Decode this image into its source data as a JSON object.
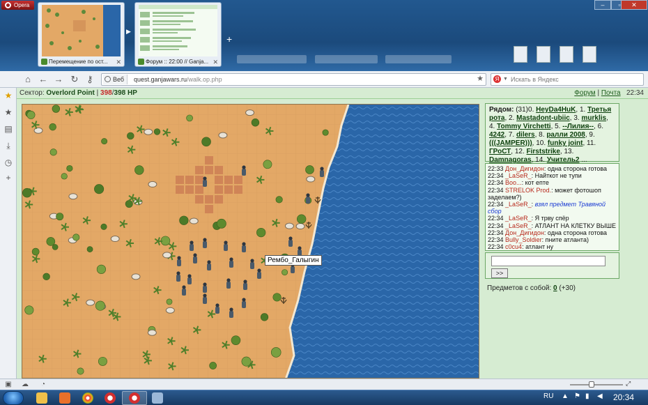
{
  "browser": {
    "menu_label": "Opera",
    "tabs": [
      {
        "title": "Перемещение по ост...",
        "close": "✕"
      },
      {
        "title": "Форум :: 22:00 // Ganja...",
        "close": "✕"
      }
    ],
    "address": {
      "badge": "Веб",
      "url_domain": "quest.ganjawars.ru",
      "url_path": "/walk.op.php"
    },
    "search_placeholder": "Искать в Яндекс",
    "yandex_letter": "Я"
  },
  "game": {
    "sector_label": "Сектор:",
    "sector_name": "Overlord Point",
    "hp_current": "398",
    "hp_sep": "/",
    "hp_max": "398 HP",
    "hp_sep_pipe": "|",
    "links": {
      "forum": "Форум",
      "mail": "Почта",
      "separator": "|"
    },
    "time": "22:34",
    "tooltip_player": "Рембо_Галыгин"
  },
  "nearby": {
    "label": "Рядом:",
    "count": "(31)",
    "players": [
      {
        "n": "0.",
        "name": "HeyDa4HuK"
      },
      {
        "n": "1.",
        "name": "Третья рота"
      },
      {
        "n": "2.",
        "name": "Mastadont-ubiic"
      },
      {
        "n": "3.",
        "name": "murklis"
      },
      {
        "n": "4.",
        "name": "Tommy Virchetti"
      },
      {
        "n": "5.",
        "name": "--Лилия--"
      },
      {
        "n": "6.",
        "name": "4242"
      },
      {
        "n": "7.",
        "name": "dilers"
      },
      {
        "n": "8.",
        "name": "ралли 2008"
      },
      {
        "n": "9.",
        "name": "(((JAMPER)))"
      },
      {
        "n": "10.",
        "name": "funky joint"
      },
      {
        "n": "11.",
        "name": "ГРоСТ"
      },
      {
        "n": "12.",
        "name": "Firststrike"
      },
      {
        "n": "13.",
        "name": "Damnagoras"
      },
      {
        "n": "14.",
        "name": "Учитель2"
      }
    ],
    "more": "..."
  },
  "chat": {
    "messages": [
      {
        "time": "22:33",
        "nick": "Дон_Дигидон",
        "text": ": одна сторона готова"
      },
      {
        "time": "22:34",
        "nick": "_LaSeR_",
        "text": ": Найткот не тупи"
      },
      {
        "time": "22:34",
        "nick": "Boo...",
        "text": ": кот епте"
      },
      {
        "time": "22:34",
        "nick": "STRELOK Prod.",
        "text": ": может фотошоп заделаем?)"
      },
      {
        "time": "22:34",
        "nick": "_LaSeR_",
        "text": ":",
        "action": "взял предмет Травяной сбор"
      },
      {
        "time": "22:34",
        "nick": "_LaSeR_",
        "text": ": Я трву спёр"
      },
      {
        "time": "22:34",
        "nick": "_LaSeR_",
        "text": ": АТЛАНТ НА КЛЕТКУ ВЫШЕ"
      },
      {
        "time": "22:34",
        "nick": "Дон_Дигидон",
        "text": ": одна сторона готова"
      },
      {
        "time": "22:34",
        "nick": "Bully_Soldier",
        "text": ": пните атланта)"
      },
      {
        "time": "22:34",
        "nick": "c0cu4",
        "text": ": атлант ну"
      }
    ],
    "input_value": "",
    "send_label": ">>"
  },
  "items": {
    "label": "Предметов с собой:",
    "count": "0",
    "extra": "(+30)"
  },
  "taskbar": {
    "lang": "RU",
    "clock": "20:34"
  },
  "colors": {
    "page_bg": "#d6ecd2",
    "sand": "#e3a866",
    "sea": "#2a66a8",
    "hp": "#c62828",
    "link": "#0c3f0c"
  }
}
